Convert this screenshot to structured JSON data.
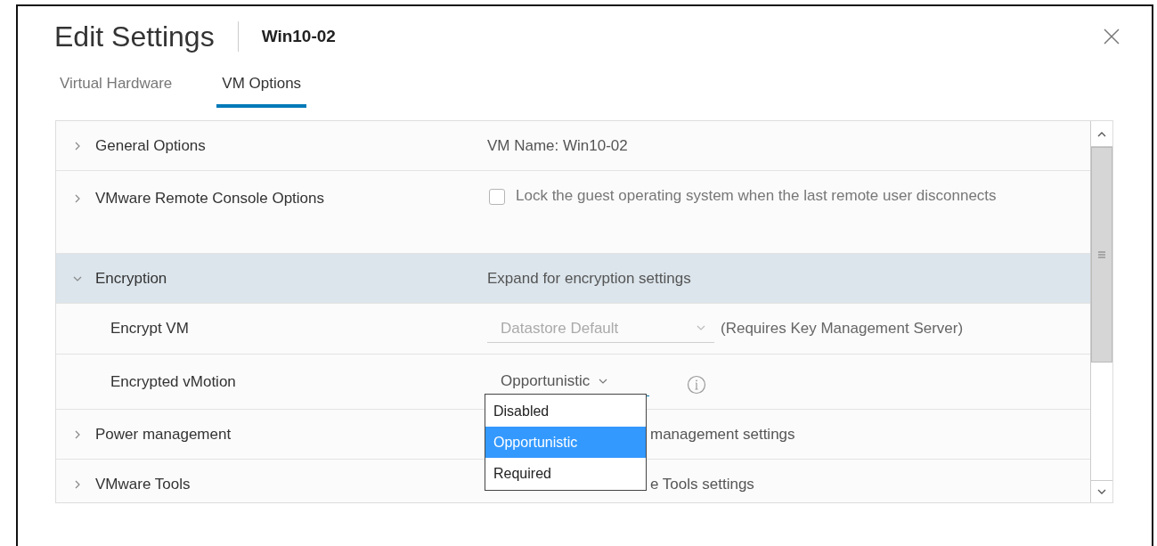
{
  "dialog": {
    "title": "Edit Settings",
    "subtitle": "Win10-02"
  },
  "tabs": [
    {
      "label": "Virtual Hardware",
      "selected": false
    },
    {
      "label": "VM Options",
      "selected": true
    }
  ],
  "rows": [
    {
      "kind": "section",
      "label": "General Options",
      "expanded": false,
      "value": "VM Name: Win10-02"
    },
    {
      "kind": "checkbox",
      "label": "VMware Remote Console Options",
      "expanded": false,
      "checked": false,
      "value": "Lock the guest operating system when the last remote user disconnects"
    },
    {
      "kind": "section",
      "label": "Encryption",
      "expanded": true,
      "value": "Expand for encryption settings"
    },
    {
      "kind": "select",
      "label": "Encrypt VM",
      "disabled": true,
      "value": "Datastore Default",
      "note": "(Requires Key Management Server)"
    },
    {
      "kind": "select",
      "label": "Encrypted vMotion",
      "disabled": false,
      "value": "Opportunistic",
      "info": true
    },
    {
      "kind": "section",
      "label": "Power management",
      "expanded": false,
      "value": "management settings",
      "partly_hidden": true
    },
    {
      "kind": "section",
      "label": "VMware Tools",
      "expanded": false,
      "value": "e Tools settings",
      "partly_hidden": true
    }
  ],
  "dropdown": {
    "options": [
      {
        "label": "Disabled",
        "selected": false
      },
      {
        "label": "Opportunistic",
        "selected": true
      },
      {
        "label": "Required",
        "selected": false
      }
    ]
  }
}
